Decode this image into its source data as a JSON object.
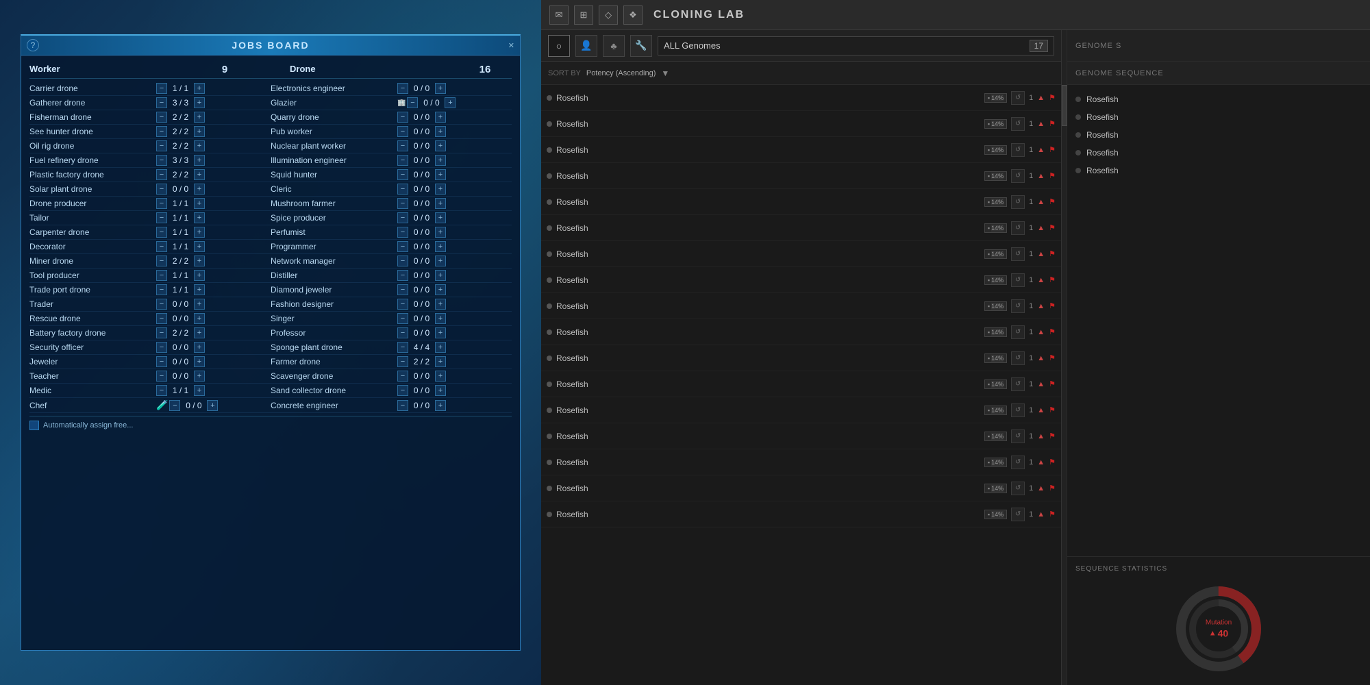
{
  "jobs_board": {
    "title": "JOBS BOARD",
    "question_mark": "?",
    "close": "✕",
    "worker_label": "Worker",
    "worker_count": "9",
    "drone_label": "Drone",
    "drone_count": "16",
    "left_jobs": [
      {
        "name": "Carrier drone",
        "current": 1,
        "max": 1,
        "icon": ""
      },
      {
        "name": "Gatherer drone",
        "current": 3,
        "max": 3,
        "icon": ""
      },
      {
        "name": "Fisherman drone",
        "current": 2,
        "max": 2,
        "icon": ""
      },
      {
        "name": "See hunter drone",
        "current": 2,
        "max": 2,
        "icon": ""
      },
      {
        "name": "Oil rig drone",
        "current": 2,
        "max": 2,
        "icon": ""
      },
      {
        "name": "Fuel refinery drone",
        "current": 3,
        "max": 3,
        "icon": ""
      },
      {
        "name": "Plastic factory drone",
        "current": 2,
        "max": 2,
        "icon": ""
      },
      {
        "name": "Solar plant drone",
        "current": 0,
        "max": 0,
        "icon": ""
      },
      {
        "name": "Drone producer",
        "current": 1,
        "max": 1,
        "icon": ""
      },
      {
        "name": "Tailor",
        "current": 1,
        "max": 1,
        "icon": ""
      },
      {
        "name": "Carpenter drone",
        "current": 1,
        "max": 1,
        "icon": ""
      },
      {
        "name": "Decorator",
        "current": 1,
        "max": 1,
        "icon": ""
      },
      {
        "name": "Miner drone",
        "current": 2,
        "max": 2,
        "icon": ""
      },
      {
        "name": "Tool producer",
        "current": 1,
        "max": 1,
        "icon": ""
      },
      {
        "name": "Trade port drone",
        "current": 1,
        "max": 1,
        "icon": ""
      },
      {
        "name": "Trader",
        "current": 0,
        "max": 0,
        "icon": ""
      },
      {
        "name": "Rescue drone",
        "current": 0,
        "max": 0,
        "icon": ""
      },
      {
        "name": "Battery factory drone",
        "current": 2,
        "max": 2,
        "icon": ""
      },
      {
        "name": "Security officer",
        "current": 0,
        "max": 0,
        "icon": ""
      },
      {
        "name": "Jeweler",
        "current": 0,
        "max": 0,
        "icon": ""
      },
      {
        "name": "Teacher",
        "current": 0,
        "max": 0,
        "icon": ""
      },
      {
        "name": "Medic",
        "current": 1,
        "max": 1,
        "icon": ""
      },
      {
        "name": "Chef",
        "current": 0,
        "max": 0,
        "icon": "flask"
      }
    ],
    "right_jobs": [
      {
        "name": "Electronics engineer",
        "current": 0,
        "max": 0,
        "icon": ""
      },
      {
        "name": "Glazier",
        "current": 0,
        "max": 0,
        "icon": "building"
      },
      {
        "name": "Quarry drone",
        "current": 0,
        "max": 0,
        "icon": ""
      },
      {
        "name": "Pub worker",
        "current": 0,
        "max": 0,
        "icon": ""
      },
      {
        "name": "Nuclear plant worker",
        "current": 0,
        "max": 0,
        "icon": ""
      },
      {
        "name": "Illumination engineer",
        "current": 0,
        "max": 0,
        "icon": ""
      },
      {
        "name": "Squid hunter",
        "current": 0,
        "max": 0,
        "icon": ""
      },
      {
        "name": "Cleric",
        "current": 0,
        "max": 0,
        "icon": ""
      },
      {
        "name": "Mushroom farmer",
        "current": 0,
        "max": 0,
        "icon": ""
      },
      {
        "name": "Spice producer",
        "current": 0,
        "max": 0,
        "icon": ""
      },
      {
        "name": "Perfumist",
        "current": 0,
        "max": 0,
        "icon": ""
      },
      {
        "name": "Programmer",
        "current": 0,
        "max": 0,
        "icon": ""
      },
      {
        "name": "Network manager",
        "current": 0,
        "max": 0,
        "icon": ""
      },
      {
        "name": "Distiller",
        "current": 0,
        "max": 0,
        "icon": ""
      },
      {
        "name": "Diamond jeweler",
        "current": 0,
        "max": 0,
        "icon": ""
      },
      {
        "name": "Fashion designer",
        "current": 0,
        "max": 0,
        "icon": ""
      },
      {
        "name": "Singer",
        "current": 0,
        "max": 0,
        "icon": ""
      },
      {
        "name": "Professor",
        "current": 0,
        "max": 0,
        "icon": ""
      },
      {
        "name": "Sponge plant drone",
        "current": 4,
        "max": 4,
        "icon": ""
      },
      {
        "name": "Farmer drone",
        "current": 2,
        "max": 2,
        "icon": ""
      },
      {
        "name": "Scavenger drone",
        "current": 0,
        "max": 0,
        "icon": ""
      },
      {
        "name": "Sand collector drone",
        "current": 0,
        "max": 0,
        "icon": ""
      },
      {
        "name": "Concrete engineer",
        "current": 0,
        "max": 0,
        "icon": ""
      }
    ],
    "footer_text": "Automatically assign free..."
  },
  "cloning_lab": {
    "title": "CLONING LAB",
    "top_icons": [
      "✉",
      "⊞",
      "◇",
      "❖"
    ],
    "filter_icons": [
      "○",
      "👤",
      "♣",
      "🔧"
    ],
    "genome_selector": "ALL Genomes",
    "genome_count": "17",
    "sort_label": "SORT BY",
    "sort_value": "Potency (Ascending)",
    "genome_sequence_title": "GENOME SEQUENCE",
    "genome_s_title": "GENOME S",
    "sequence_stats_title": "SEQUENCE STATISTICS",
    "genomes": [
      {
        "name": "Rosefish",
        "percent": "14%",
        "count": "1"
      },
      {
        "name": "Rosefish",
        "percent": "14%",
        "count": "1"
      },
      {
        "name": "Rosefish",
        "percent": "14%",
        "count": "1"
      },
      {
        "name": "Rosefish",
        "percent": "14%",
        "count": "1"
      },
      {
        "name": "Rosefish",
        "percent": "14%",
        "count": "1"
      },
      {
        "name": "Rosefish",
        "percent": "14%",
        "count": "1"
      },
      {
        "name": "Rosefish",
        "percent": "14%",
        "count": "1"
      },
      {
        "name": "Rosefish",
        "percent": "14%",
        "count": "1"
      },
      {
        "name": "Rosefish",
        "percent": "14%",
        "count": "1"
      },
      {
        "name": "Rosefish",
        "percent": "14%",
        "count": "1"
      },
      {
        "name": "Rosefish",
        "percent": "14%",
        "count": "1"
      },
      {
        "name": "Rosefish",
        "percent": "14%",
        "count": "1"
      },
      {
        "name": "Rosefish",
        "percent": "14%",
        "count": "1"
      },
      {
        "name": "Rosefish",
        "percent": "14%",
        "count": "1"
      },
      {
        "name": "Rosefish",
        "percent": "14%",
        "count": "1"
      },
      {
        "name": "Rosefish",
        "percent": "14%",
        "count": "1"
      },
      {
        "name": "Rosefish",
        "percent": "14%",
        "count": "1"
      }
    ],
    "sequence_items": [
      "Rosefish",
      "Rosefish",
      "Rosefish",
      "Rosefish",
      "Rosefish"
    ],
    "mutation_label": "Mutation",
    "mutation_value": "40",
    "mutation_icon": "▲"
  }
}
